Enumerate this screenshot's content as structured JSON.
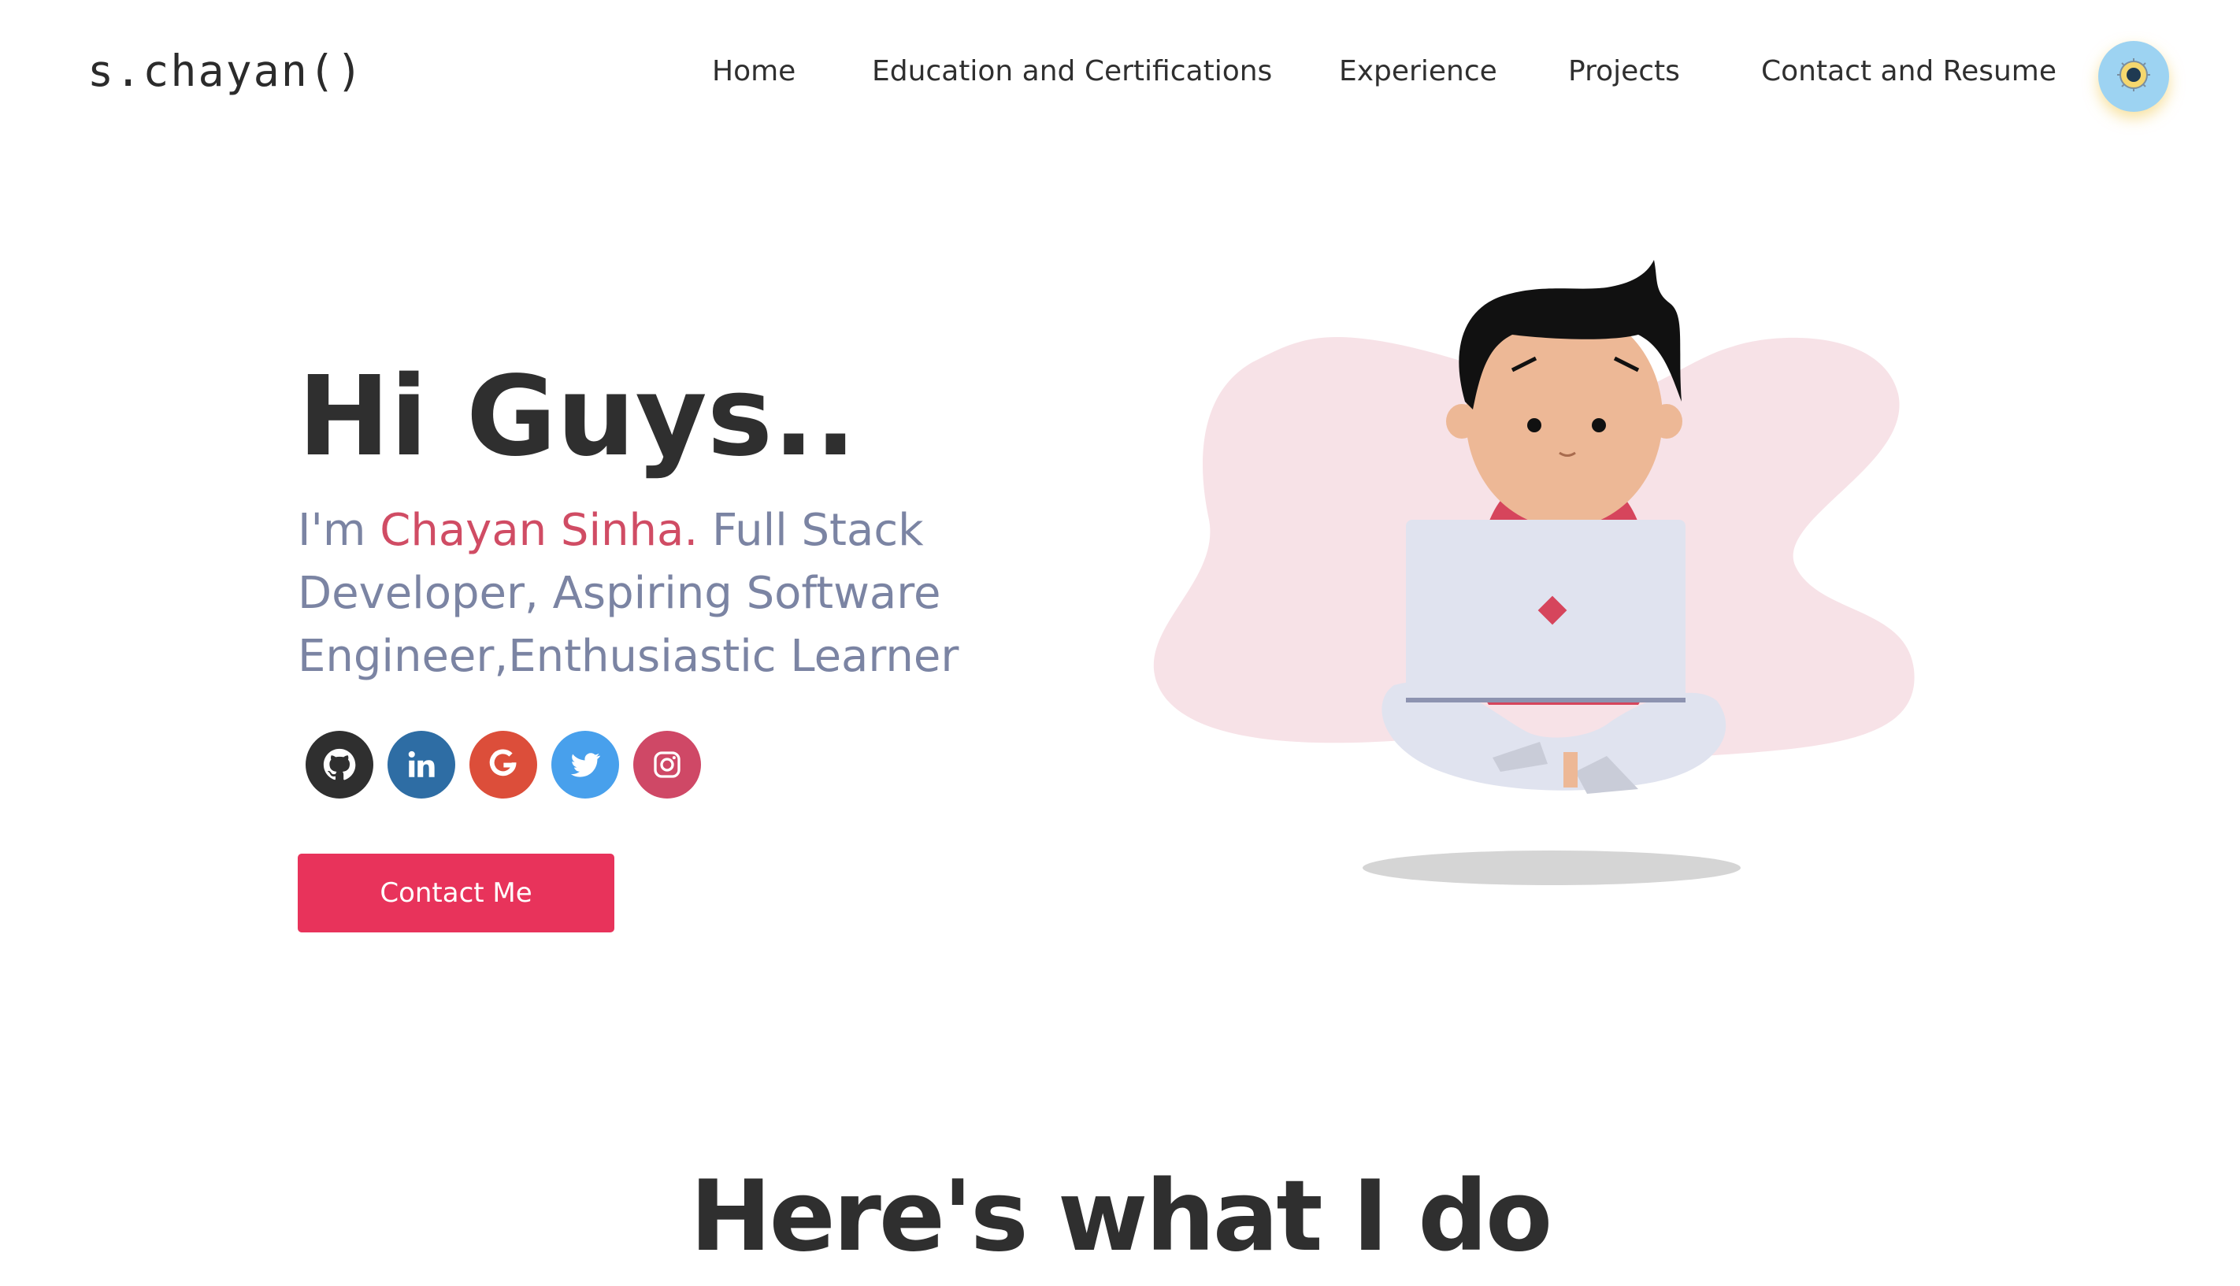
{
  "header": {
    "logo": "s.chayan()",
    "nav": [
      {
        "label": "Home"
      },
      {
        "label": "Education and Certifications"
      },
      {
        "label": "Experience"
      },
      {
        "label": "Projects"
      },
      {
        "label": "Contact and Resume"
      }
    ],
    "theme_toggle_icon": "sun-icon"
  },
  "hero": {
    "greeting": "Hi Guys..",
    "intro_prefix": "I'm ",
    "name": "Chayan Sinha.",
    "intro_rest": " Full Stack Developer, Aspiring Software Engineer,Enthusiastic Learner",
    "socials": [
      {
        "name": "github",
        "icon": "github-icon",
        "color": "#2f2f2f"
      },
      {
        "name": "linkedin",
        "icon": "linkedin-icon",
        "color": "#2e6da4"
      },
      {
        "name": "google",
        "icon": "google-icon",
        "color": "#dc4e3a"
      },
      {
        "name": "twitter",
        "icon": "twitter-icon",
        "color": "#48a0ec"
      },
      {
        "name": "instagram",
        "icon": "instagram-icon",
        "color": "#cf4866"
      }
    ],
    "contact_button": "Contact Me"
  },
  "section": {
    "title": "Here's what I do"
  },
  "colors": {
    "accent": "#e8335b",
    "name_highlight": "#d04c64",
    "subtitle": "#7b84a3",
    "blob": "#f7e2e7"
  }
}
